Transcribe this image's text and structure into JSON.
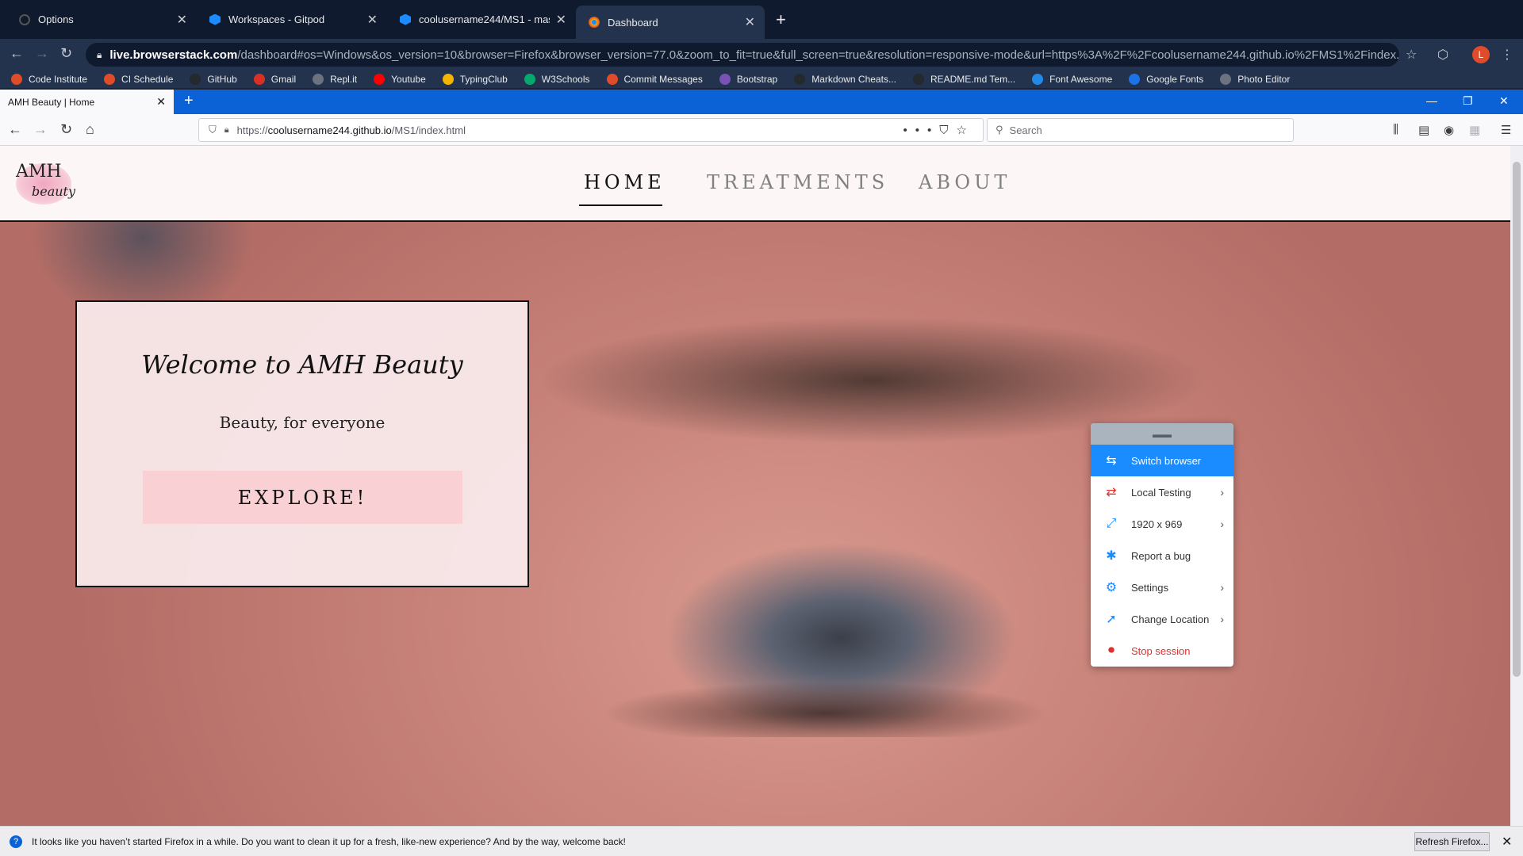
{
  "chrome": {
    "tabs": [
      {
        "title": "Options",
        "active": false
      },
      {
        "title": "Workspaces - Gitpod",
        "active": false
      },
      {
        "title": "coolusername244/MS1 - maste",
        "active": false
      },
      {
        "title": "Dashboard",
        "active": true
      }
    ],
    "url_host": "live.browserstack.com",
    "url_rest": "/dashboard#os=Windows&os_version=10&browser=Firefox&browser_version=77.0&zoom_to_fit=true&full_screen=true&resolution=responsive-mode&url=https%3A%2F%2Fcoolusername244.github.io%2FMS1%2Findex.html&s...",
    "avatar_letter": "L",
    "bookmarks": [
      {
        "label": "Code Institute",
        "color": "#e04b2a"
      },
      {
        "label": "CI Schedule",
        "color": "#e04b2a"
      },
      {
        "label": "GitHub",
        "color": "#24292e"
      },
      {
        "label": "Gmail",
        "color": "#d93025"
      },
      {
        "label": "Repl.it",
        "color": "#6b7280"
      },
      {
        "label": "Youtube",
        "color": "#ff0000"
      },
      {
        "label": "TypingClub",
        "color": "#f4b400"
      },
      {
        "label": "W3Schools",
        "color": "#04aa6d"
      },
      {
        "label": "Commit Messages",
        "color": "#e04b2a"
      },
      {
        "label": "Bootstrap",
        "color": "#7952b3"
      },
      {
        "label": "Markdown Cheats...",
        "color": "#24292e"
      },
      {
        "label": "README.md Tem...",
        "color": "#24292e"
      },
      {
        "label": "Font Awesome",
        "color": "#228ae6"
      },
      {
        "label": "Google Fonts",
        "color": "#1a73e8"
      },
      {
        "label": "Photo Editor",
        "color": "#6b7280"
      }
    ]
  },
  "firefox": {
    "tab_title": "AMH Beauty | Home",
    "url_prefix": "https://",
    "url_host": "coolusername244.github.io",
    "url_path": "/MS1/index.html",
    "search_placeholder": "Search"
  },
  "site": {
    "logo_line1": "AMH",
    "logo_line2": "beauty",
    "nav": [
      {
        "label": "HOME",
        "active": true
      },
      {
        "label": "TREATMENTS",
        "active": false
      },
      {
        "label": "ABOUT",
        "active": false
      }
    ],
    "welcome_title": "Welcome to AMH Beauty",
    "welcome_subtitle": "Beauty, for everyone",
    "explore_button": "EXPLORE!"
  },
  "bs_menu": {
    "items": [
      {
        "label": "Switch browser",
        "icon": "switch-icon",
        "selected": true,
        "chevron": false
      },
      {
        "label": "Local Testing",
        "icon": "local-testing-icon",
        "selected": false,
        "chevron": true
      },
      {
        "label": "1920 x 969",
        "icon": "resize-icon",
        "selected": false,
        "chevron": true
      },
      {
        "label": "Report a bug",
        "icon": "bug-icon",
        "selected": false,
        "chevron": false
      },
      {
        "label": "Settings",
        "icon": "gear-icon",
        "selected": false,
        "chevron": true
      },
      {
        "label": "Change Location",
        "icon": "location-arrow-icon",
        "selected": false,
        "chevron": true
      },
      {
        "label": "Stop session",
        "icon": "stop-icon",
        "selected": false,
        "chevron": false
      }
    ]
  },
  "notification": {
    "message": "It looks like you haven’t started Firefox in a while. Do you want to clean it up for a fresh, like-new experience? And by the way, welcome back!",
    "button": "Refresh Firefox..."
  }
}
